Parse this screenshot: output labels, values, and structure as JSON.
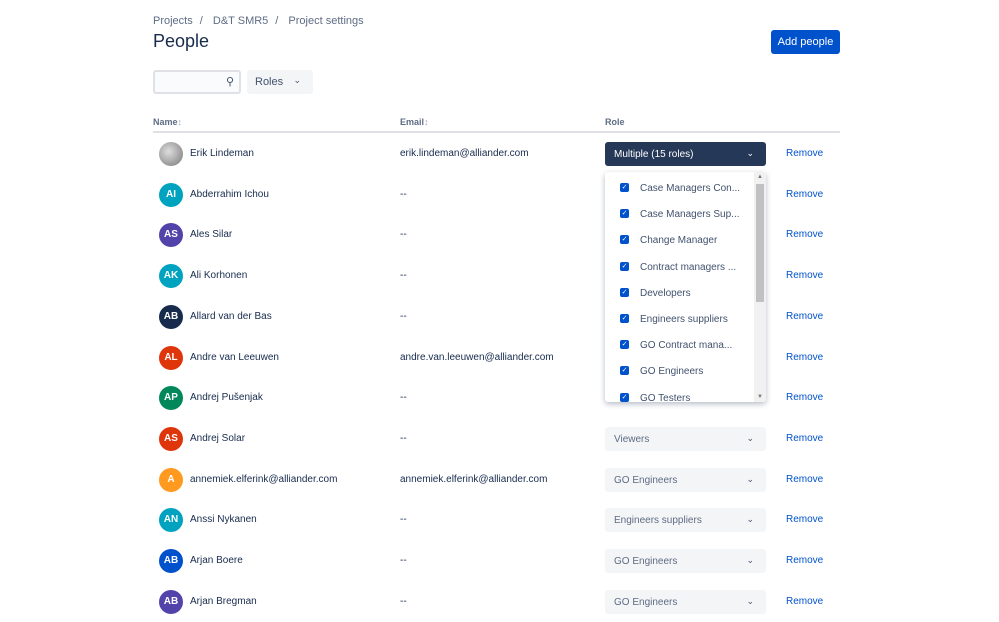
{
  "breadcrumbs": [
    "Projects",
    "D&T SMR5",
    "Project settings"
  ],
  "title": "People",
  "add_button": "Add people",
  "search": {
    "placeholder": "",
    "icon": "search-icon"
  },
  "roles_filter": "Roles",
  "columns": {
    "name": "Name",
    "email": "Email",
    "role": "Role"
  },
  "remove_label": "Remove",
  "rows": [
    {
      "initials": "",
      "name": "Erik Lindeman",
      "email": "erik.lindeman@alliander.com",
      "role": "Multiple (15 roles)",
      "color": "#8a8a8a",
      "photo": true
    },
    {
      "initials": "AI",
      "name": "Abderrahim Ichou",
      "email": "--",
      "role": null,
      "color": "#00a3bf"
    },
    {
      "initials": "AS",
      "name": "Ales Silar",
      "email": "--",
      "role": null,
      "color": "#5243aa"
    },
    {
      "initials": "AK",
      "name": "Ali Korhonen",
      "email": "--",
      "role": null,
      "color": "#00a3bf"
    },
    {
      "initials": "AB",
      "name": "Allard van der Bas",
      "email": "--",
      "role": null,
      "color": "#172b4d"
    },
    {
      "initials": "AL",
      "name": "Andre van Leeuwen",
      "email": "andre.van.leeuwen@alliander.com",
      "role": null,
      "color": "#de350b"
    },
    {
      "initials": "AP",
      "name": "Andrej Pušenjak",
      "email": "--",
      "role": null,
      "color": "#00875a"
    },
    {
      "initials": "AS",
      "name": "Andrej Solar",
      "email": "--",
      "role": "Viewers",
      "color": "#de350b"
    },
    {
      "initials": "A",
      "name": "annemiek.elferink@alliander.com",
      "email": "annemiek.elferink@alliander.com",
      "role": "GO Engineers",
      "color": "#ff991f"
    },
    {
      "initials": "AN",
      "name": "Anssi Nykanen",
      "email": "--",
      "role": "Engineers suppliers",
      "color": "#00a3bf"
    },
    {
      "initials": "AB",
      "name": "Arjan Boere",
      "email": "--",
      "role": "GO Engineers",
      "color": "#0052cc"
    },
    {
      "initials": "AB",
      "name": "Arjan Bregman",
      "email": "--",
      "role": "GO Engineers",
      "color": "#5243aa"
    }
  ],
  "role_dropdown": [
    "Case Managers Con...",
    "Case Managers Sup...",
    "Change Manager",
    "Contract managers ...",
    "Developers",
    "Engineers suppliers",
    "GO Contract mana...",
    "GO Engineers",
    "GO Testers"
  ]
}
